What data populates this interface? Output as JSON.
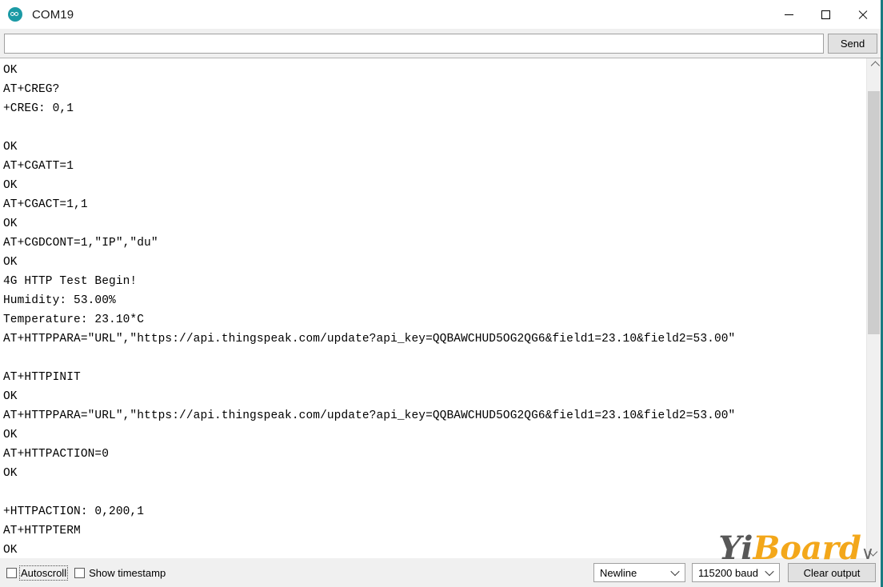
{
  "window": {
    "title": "COM19",
    "app_icon": "arduino-logo-icon",
    "accent_color": "#1a7b81",
    "minimize_label": "Minimize",
    "maximize_label": "Maximize",
    "close_label": "Close"
  },
  "send_bar": {
    "input_value": "",
    "input_placeholder": "",
    "send_label": "Send"
  },
  "console": {
    "lines": [
      "OK",
      "AT+CREG?",
      "+CREG: 0,1",
      "",
      "OK",
      "AT+CGATT=1",
      "OK",
      "AT+CGACT=1,1",
      "OK",
      "AT+CGDCONT=1,\"IP\",\"du\"",
      "OK",
      "4G HTTP Test Begin!",
      "Humidity: 53.00%",
      "Temperature: 23.10*C",
      "AT+HTTPPARA=\"URL\",\"https://api.thingspeak.com/update?api_key=QQBAWCHUD5OG2QG6&field1=23.10&field2=53.00\"",
      "",
      "AT+HTTPINIT",
      "OK",
      "AT+HTTPPARA=\"URL\",\"https://api.thingspeak.com/update?api_key=QQBAWCHUD5OG2QG6&field1=23.10&field2=53.00\"",
      "OK",
      "AT+HTTPACTION=0",
      "OK",
      "",
      "+HTTPACTION: 0,200,1",
      "AT+HTTPTERM",
      "OK"
    ]
  },
  "scrollbar": {
    "up_arrow": "chevron-up-icon",
    "down_arrow": "chevron-down-icon"
  },
  "status_bar": {
    "autoscroll_label": "Autoscroll",
    "autoscroll_checked": false,
    "timestamp_label": "Show timestamp",
    "timestamp_checked": false,
    "line_ending_value": "Newline",
    "baud_rate_value": "115200 baud",
    "clear_label": "Clear output"
  },
  "watermark": {
    "part1": "Yi",
    "part2": "Board",
    "color1": "#4a4a4a",
    "color2": "#f2a007"
  }
}
